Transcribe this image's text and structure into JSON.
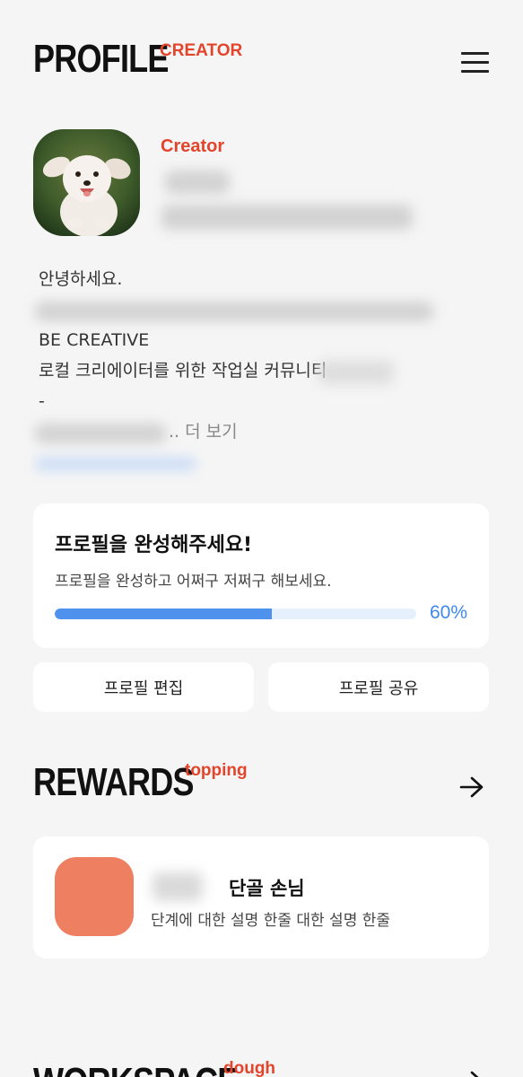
{
  "header": {
    "title": "PROFILE",
    "tag": "CREATOR"
  },
  "profile": {
    "role": "Creator",
    "bio": {
      "greeting": "안녕하세요.",
      "motto": "BE CREATIVE",
      "description": "로컬 크리에이터를 위한 작업실 커뮤니티",
      "dash": "-",
      "more": ".. 더 보기"
    }
  },
  "completion": {
    "title": "프로필을 완성해주세요!",
    "subtitle": "프로필을 완성하고 어쩌구 저쩌구 해보세요.",
    "progress": 0.6,
    "progress_label": "60%"
  },
  "actions": {
    "edit_label": "프로필 편집",
    "share_label": "프로필 공유"
  },
  "rewards": {
    "title": "REWARDS",
    "tag": "topping",
    "item": {
      "name": "단골 손님",
      "description": "단계에 대한 설명 한줄 대한 설명 한줄",
      "badge_color": "#ef7f61"
    }
  },
  "workspace": {
    "title": "WORKSPACE",
    "tag": "dough"
  },
  "colors": {
    "accent": "#e2452c",
    "progress": "#4e92ee"
  }
}
